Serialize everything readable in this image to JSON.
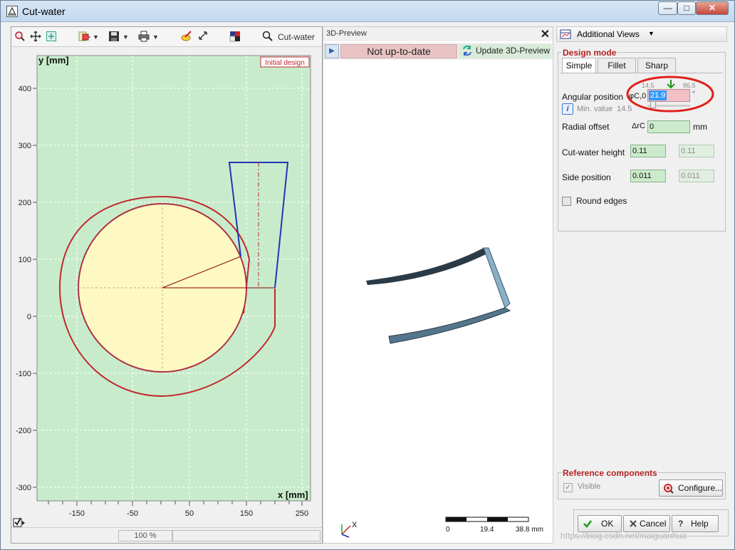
{
  "window": {
    "title": "Cut-water",
    "controls": [
      "—",
      "□",
      "✕"
    ]
  },
  "toolbar": {
    "cutwater_label": "Cut-water"
  },
  "plot": {
    "badge": "Initial design",
    "y_axis_label": "y [mm]",
    "x_axis_label": "x [mm]",
    "y_ticks": [
      "400",
      "300",
      "200",
      "100",
      "0",
      "-100",
      "-200",
      "-300"
    ],
    "x_ticks": [
      "-150",
      "-50",
      "50",
      "150",
      "250"
    ],
    "colors": {
      "background": "#c8eccb",
      "disk_fill": "#fef9c3",
      "volute": "#c0282e",
      "outlet": "#2233bb",
      "radius_line": "#8b0000"
    }
  },
  "status": {
    "zoom": "100 %"
  },
  "preview": {
    "title": "3D-Preview",
    "close": "✕",
    "status": "Not up-to-date",
    "update_label": "Update 3D-Preview",
    "scale": {
      "labels": [
        "0",
        "19.4",
        "38.8 mm"
      ]
    },
    "axis_label": "X"
  },
  "right": {
    "additional_views": "Additional Views",
    "design_mode_label": "Design mode",
    "tabs": [
      {
        "label": "Simple",
        "active": true
      },
      {
        "label": "Fillet",
        "active": false
      },
      {
        "label": "Sharp",
        "active": false
      }
    ],
    "angular": {
      "label": "Angular position",
      "symbol": "φC,0",
      "value": "21.9",
      "unit": "°",
      "min_tick": "14.5",
      "max_tick": "86.5"
    },
    "min_value": {
      "label": "Min. value",
      "value": "14.5"
    },
    "radial_offset": {
      "label": "Radial offset",
      "symbol": "ΔrC",
      "value": "0",
      "unit": "mm"
    },
    "cutwater_height": {
      "label": "Cut-water height",
      "value": "0.11",
      "value2": "0.11"
    },
    "side_position": {
      "label": "Side position",
      "value": "0.011",
      "value2": "0.011"
    },
    "round_edges": {
      "label": "Round edges",
      "checked": false
    },
    "reference": {
      "label": "Reference components",
      "visible_label": "Visible",
      "configure_label": "Configure..."
    },
    "buttons": {
      "ok": "OK",
      "cancel": "Cancel",
      "help": "Help"
    }
  },
  "watermark": "https://blog.csdn.net/maiguanhua"
}
